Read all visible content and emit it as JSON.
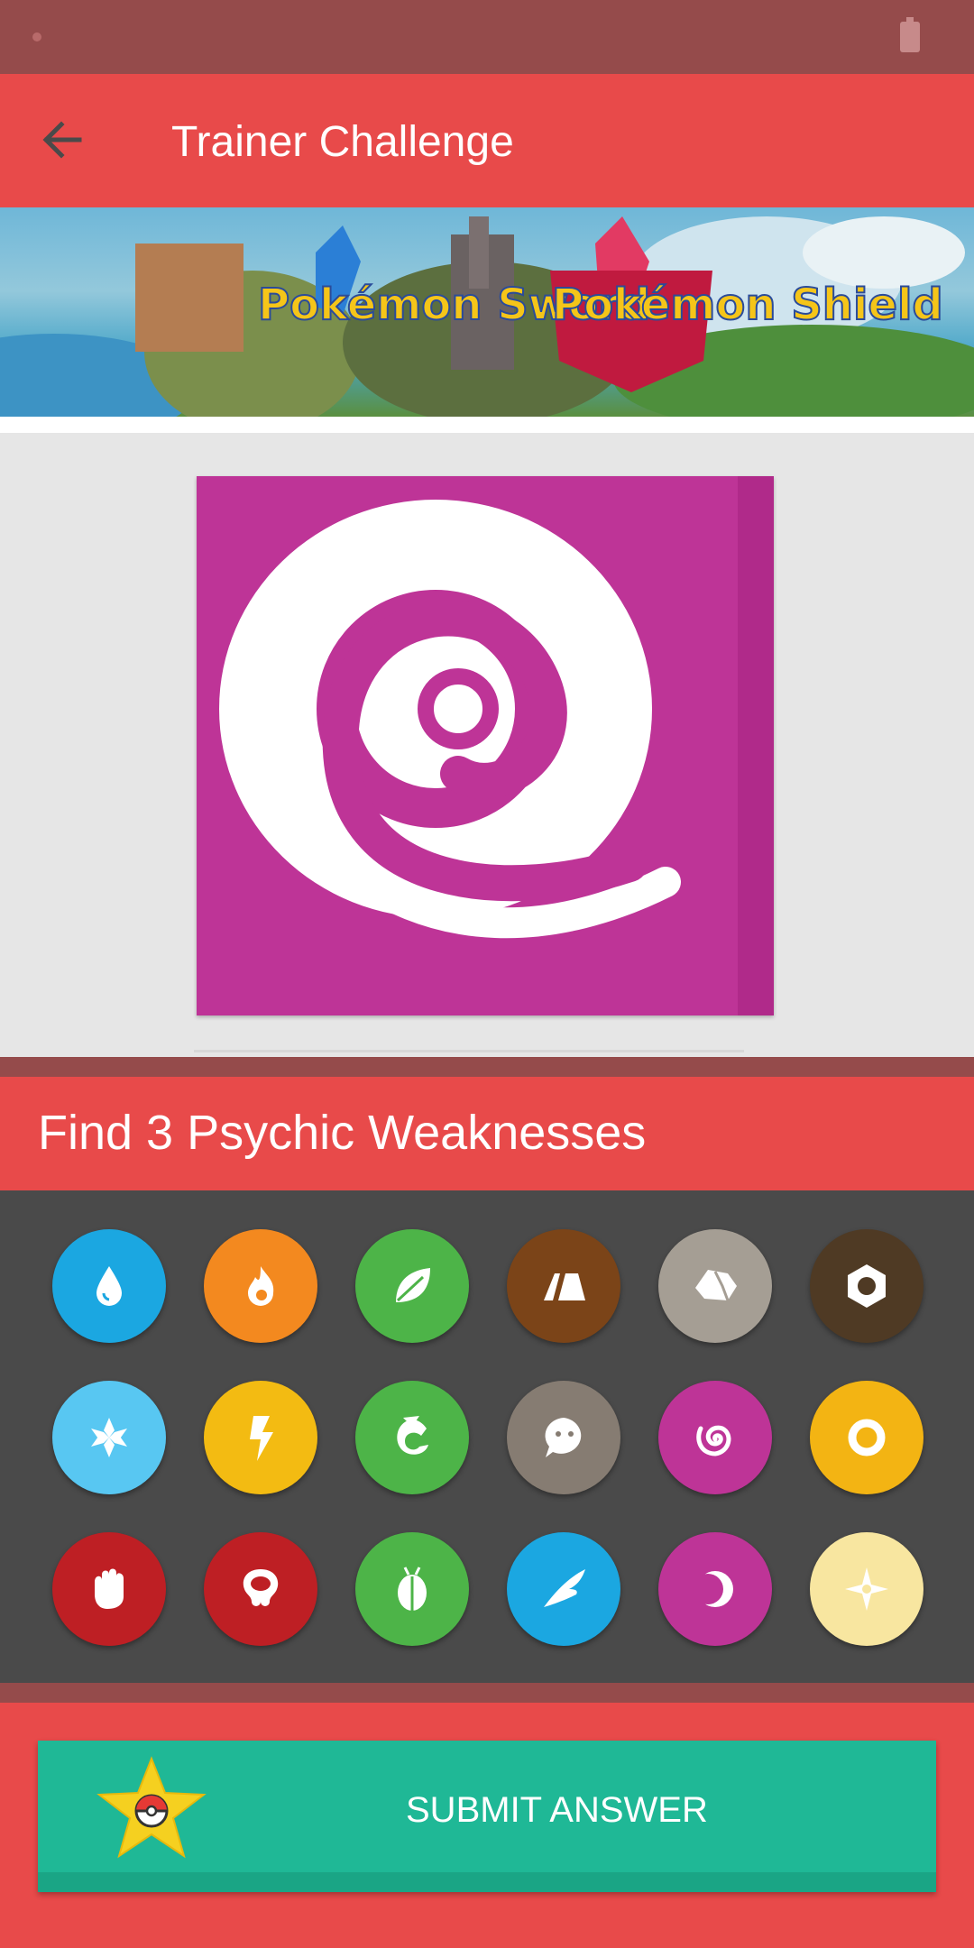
{
  "app_bar": {
    "title": "Trainer Challenge",
    "back_icon": "arrow-left-icon"
  },
  "banner": {
    "sword_logo": "Pokémon Sword",
    "shield_logo": "Pokémon Shield"
  },
  "question": {
    "text": "Find 3 Psychic Weaknesses",
    "shown_type": "psychic"
  },
  "types": [
    {
      "name": "water",
      "icon": "water-drop-icon",
      "color": "#1ba7e1"
    },
    {
      "name": "fire",
      "icon": "flame-icon",
      "color": "#f3891f"
    },
    {
      "name": "grass",
      "icon": "leaf-icon",
      "color": "#4db448"
    },
    {
      "name": "ground",
      "icon": "ground-icon",
      "color": "#7b4418"
    },
    {
      "name": "rock",
      "icon": "rock-icon",
      "color": "#a59e94"
    },
    {
      "name": "steel",
      "icon": "hex-nut-icon",
      "color": "#4f3a24"
    },
    {
      "name": "ice",
      "icon": "snowflake-icon",
      "color": "#58c7f2"
    },
    {
      "name": "electric",
      "icon": "lightning-icon",
      "color": "#f3bb12"
    },
    {
      "name": "dragon",
      "icon": "dragon-icon",
      "color": "#4db448"
    },
    {
      "name": "normal",
      "icon": "face-icon",
      "color": "#867c72"
    },
    {
      "name": "psychic",
      "icon": "spiral-icon",
      "color": "#be3497"
    },
    {
      "name": "electric-ring",
      "icon": "ring-icon",
      "color": "#f3b413"
    },
    {
      "name": "fighting",
      "icon": "fist-icon",
      "color": "#be1f24"
    },
    {
      "name": "poison",
      "icon": "skull-icon",
      "color": "#be1f24"
    },
    {
      "name": "bug",
      "icon": "bug-icon",
      "color": "#4db448"
    },
    {
      "name": "flying",
      "icon": "wing-icon",
      "color": "#1ba7e1"
    },
    {
      "name": "dark",
      "icon": "crescent-moon-icon",
      "color": "#be3497"
    },
    {
      "name": "fairy",
      "icon": "sparkle-icon",
      "color": "#f8e6a0"
    }
  ],
  "submit": {
    "label": "SUBMIT ANSWER",
    "icon": "star-pokeball-icon"
  },
  "colors": {
    "primary": "#e84a4a",
    "primary_dark": "#954b4b",
    "accent": "#1fb896"
  }
}
